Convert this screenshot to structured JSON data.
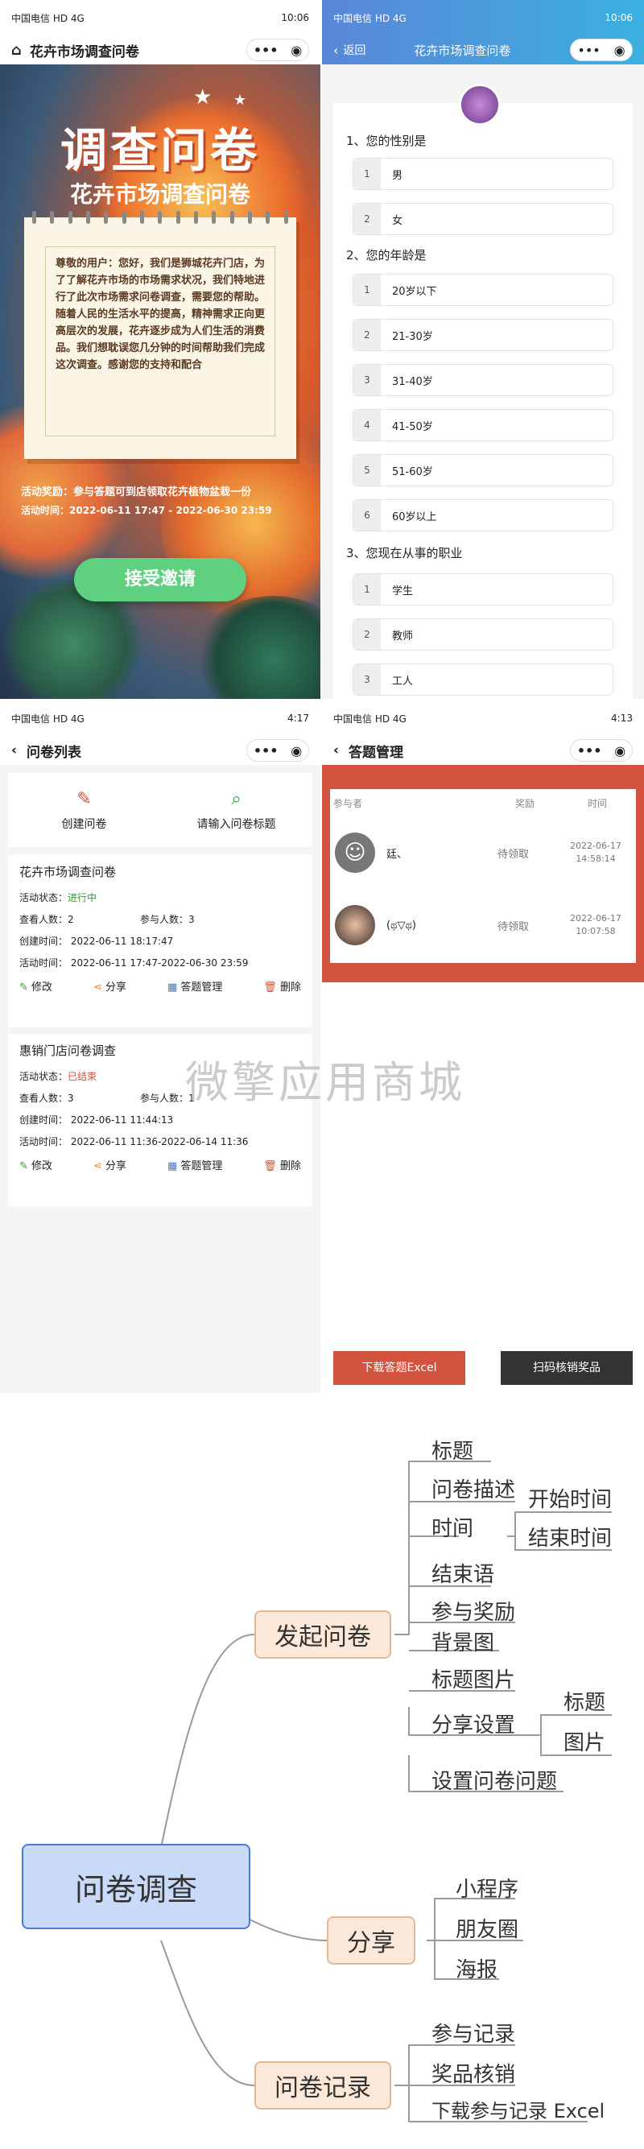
{
  "screen1": {
    "status_left": "中国电信 HD 4G",
    "status_right": "10:06",
    "nav_title": "花卉市场调查问卷",
    "poster_title": "调查问卷",
    "poster_subtitle": "花卉市场调查问卷",
    "intro": "尊敬的用户：您好，我们是狮城花卉门店，为了了解花卉市场的市场需求状况，我们特地进行了此次市场需求问卷调查，需要您的帮助。随着人民的生活水平的提高，精神需求正向更高层次的发展，花卉逐步成为人们生活的消费品。我们想耽误您几分钟的时间帮助我们完成这次调查。感谢您的支持和配合",
    "reward": "活动奖励：参与答题可到店领取花卉植物盆栽一份",
    "time": "活动时间：2022-06-11 17:47 - 2022-06-30 23:59",
    "accept_button": "接受邀请"
  },
  "screen2": {
    "status_left": "中国电信 HD 4G",
    "status_right": "10:06",
    "back_label": "返回",
    "nav_title": "花卉市场调查问卷",
    "questions": [
      {
        "title": "1、您的性别是",
        "options": [
          "男",
          "女"
        ]
      },
      {
        "title": "2、您的年龄是",
        "options": [
          "20岁以下",
          "21-30岁",
          "31-40岁",
          "41-50岁",
          "51-60岁",
          "60岁以上"
        ]
      },
      {
        "title": "3、您现在从事的职业",
        "options": [
          "学生",
          "教师",
          "工人"
        ]
      }
    ]
  },
  "screen3": {
    "status_left": "中国电信 HD 4G",
    "status_right": "4:17",
    "nav_title": "问卷列表",
    "create_label": "创建问卷",
    "search_label": "请输入问卷标题",
    "cards": [
      {
        "title": "花卉市场调查问卷",
        "status_label": "活动状态：",
        "status": "进行中",
        "status_color": "#2aa32a",
        "views_label": "查看人数：",
        "views": "2",
        "joins_label": "参与人数：",
        "joins": "3",
        "created": "创建时间：  2022-06-11 18:17:47",
        "active": "活动时间：  2022-06-11 17:47-2022-06-30 23:59"
      },
      {
        "title": "惠销门店问卷调查",
        "status_label": "活动状态：",
        "status": "已结束",
        "status_color": "#d3533f",
        "views_label": "查看人数：",
        "views": "3",
        "joins_label": "参与人数：",
        "joins": "1",
        "created": "创建时间：  2022-06-11 11:44:13",
        "active": "活动时间：  2022-06-11 11:36-2022-06-14 11:36"
      }
    ],
    "actions": [
      "修改",
      "分享",
      "答题管理",
      "删除"
    ]
  },
  "screen4": {
    "status_left": "中国电信 HD 4G",
    "status_right": "4:13",
    "nav_title": "答题管理",
    "headers": [
      "参与者",
      "奖励",
      "时间"
    ],
    "rows": [
      {
        "name": "廷、",
        "reward": "待领取",
        "date": "2022-06-17",
        "clock": "14:58:14"
      },
      {
        "name": "(ಥ▽ಥ)",
        "reward": "待领取",
        "date": "2022-06-17",
        "clock": "10:07:58"
      }
    ],
    "download_button": "下载答题Excel",
    "scan_button": "扫码核销奖品"
  },
  "watermark": "微擎应用商城",
  "mindmap": {
    "root": "问卷调查",
    "branches": [
      {
        "label": "发起问卷",
        "children": [
          "标题",
          "问卷描述",
          "时间",
          "开始时间",
          "结束时间",
          "结束语",
          "参与奖励",
          "背景图",
          "标题图片",
          "分享设置",
          "标题",
          "图片",
          "设置问卷问题"
        ]
      },
      {
        "label": "分享",
        "children": [
          "小程序",
          "朋友圈",
          "海报"
        ]
      },
      {
        "label": "问卷记录",
        "children": [
          "参与记录",
          "奖品核销",
          "下载参与记录 Excel"
        ]
      }
    ]
  },
  "icons": {
    "home": "home-icon",
    "more": "more-dots-icon",
    "record": "record-circle-icon",
    "back": "chevron-left-icon",
    "edit": "edit-icon",
    "share": "share-icon",
    "manage": "chart-icon",
    "delete": "trash-icon",
    "search": "search-icon",
    "create": "document-edit-icon"
  }
}
